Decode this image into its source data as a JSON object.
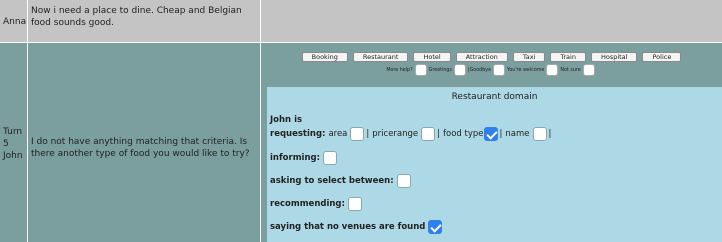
{
  "turn_prev": {
    "speaker": "Anna",
    "message": "Now i need a place to dine. Cheap and Belgian food sounds good."
  },
  "turn_current": {
    "turn_label": "Turn",
    "turn_number": "5",
    "speaker": "John",
    "message": "I do not have anything matching that criteria. Is there another type of food you would like to try?"
  },
  "domain_buttons": [
    "Booking",
    "Restaurant",
    "Hotel",
    "Attraction",
    "Taxi",
    "Train",
    "Hospital",
    "Police"
  ],
  "help_items": [
    "More help?",
    "Greetings",
    "Goodbye",
    "You're welcome",
    "Not sure"
  ],
  "panel": {
    "title": "Restaurant domain",
    "speaker_line": "John is",
    "requesting_label": "requesting:",
    "slots": [
      {
        "label": "area",
        "checked": false
      },
      {
        "label": "pricerange",
        "checked": false
      },
      {
        "label": "food type",
        "checked": true
      },
      {
        "label": "name",
        "checked": false
      }
    ],
    "separator": "|",
    "informing_label": "informing:",
    "informing_checked": false,
    "select_label": "asking to select between:",
    "select_checked": false,
    "recommending_label": "recommending:",
    "recommending_checked": false,
    "no_venues_label": "saying that no venues are found",
    "no_venues_checked": true
  },
  "colors": {
    "row_prev_bg": "#c4c4c4",
    "row_current_bg": "#7a9f9e",
    "panel_bg": "#add8e6",
    "checked_blue": "#2f80ed"
  }
}
